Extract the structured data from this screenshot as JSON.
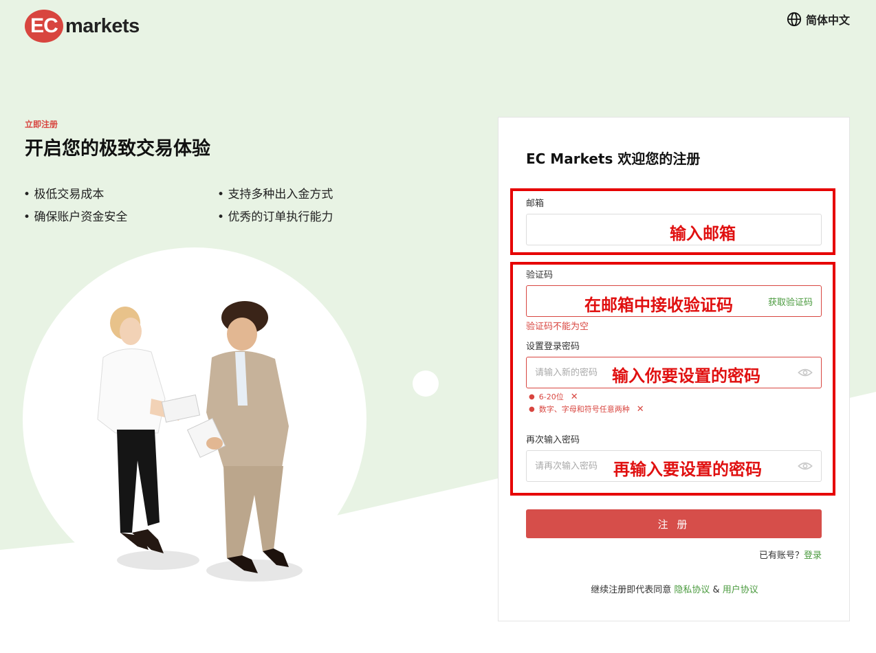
{
  "header": {
    "logo_mark": "EC",
    "logo_text": "markets",
    "language": "简体中文",
    "language_icon": "globe-icon"
  },
  "hero": {
    "eyebrow": "立即注册",
    "title": "开启您的极致交易体验",
    "features": [
      "极低交易成本",
      "支持多种出入金方式",
      "确保账户资金安全",
      "优秀的订单执行能力"
    ]
  },
  "form": {
    "title": "EC Markets 欢迎您的注册",
    "email": {
      "label": "邮箱",
      "value": "",
      "annotation": "输入邮箱"
    },
    "code": {
      "label": "验证码",
      "value": "",
      "annotation": "在邮箱中接收验证码",
      "get_code_label": "获取验证码",
      "error": "验证码不能为空"
    },
    "password": {
      "label": "设置登录密码",
      "placeholder": "请输入新的密码",
      "annotation": "输入你要设置的密码",
      "rules": [
        "6-20位",
        "数字、字母和符号任意两种"
      ],
      "rule_fail_mark": "✕"
    },
    "confirm": {
      "label": "再次输入密码",
      "placeholder": "请再次输入密码",
      "annotation": "再输入要设置的密码"
    },
    "submit_label": "注 册",
    "have_account": "已有账号？",
    "login_link": "登录",
    "agree_prefix": "继续注册即代表同意",
    "privacy_link": "隐私协议",
    "agree_and": "&",
    "terms_link": "用户协议"
  },
  "colors": {
    "brand_red": "#d8453f",
    "annotation_red": "#e60000",
    "link_green": "#4a9a3e",
    "bg_green": "#e8f3e4"
  }
}
